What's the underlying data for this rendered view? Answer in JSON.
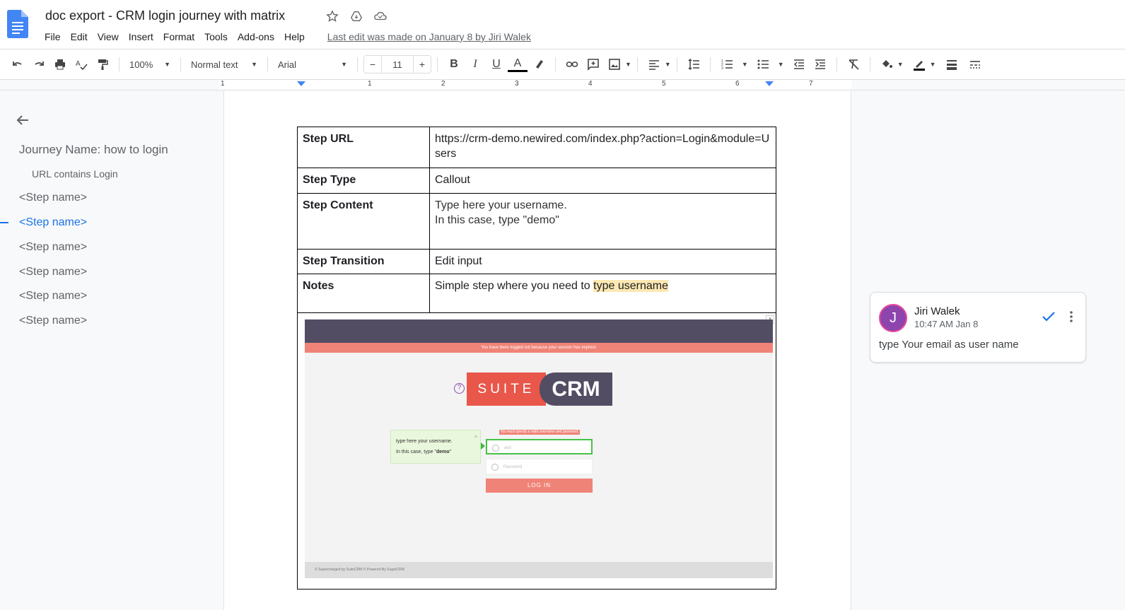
{
  "doc": {
    "title": "doc export - CRM login journey with matrix",
    "last_edit": "Last edit was made on January 8 by Jiri Walek"
  },
  "menu": [
    "File",
    "Edit",
    "View",
    "Insert",
    "Format",
    "Tools",
    "Add-ons",
    "Help"
  ],
  "toolbar": {
    "zoom": "100%",
    "style": "Normal text",
    "font": "Arial",
    "font_size": "11",
    "minus": "−",
    "plus": "+",
    "bold": "B",
    "italic": "I",
    "underline": "U",
    "text_color": "A"
  },
  "ruler": [
    "1",
    "1",
    "2",
    "3",
    "4",
    "5",
    "6",
    "7"
  ],
  "outline": {
    "title": "Journey Name: how to login",
    "subtitle": "URL contains Login",
    "items": [
      "<Step name>",
      "<Step name>",
      "<Step name>",
      "<Step name>",
      "<Step name>",
      "<Step name>"
    ],
    "active_index": 1
  },
  "table": {
    "rows": [
      {
        "key": "Step URL",
        "value": "https://crm-demo.newired.com/index.php?action=Login&module=Users"
      },
      {
        "key": "Step Type",
        "value": "Callout"
      },
      {
        "key": "Step Content",
        "value_line1": "Type here your username.",
        "value_line2": "In this case, type \"demo\""
      },
      {
        "key": "Step Transition",
        "value": "Edit input"
      },
      {
        "key": "Notes",
        "value_prefix": "Simple step where you need to ",
        "value_highlight": "type username"
      }
    ]
  },
  "screenshot": {
    "session_msg": "You have been logged out because your session has expired.",
    "logo_left": "SUITE",
    "logo_right": "CRM",
    "error_msg": "You must specify a valid username and password.",
    "callout_line1": "type here your username.",
    "callout_line2_prefix": "In this case, type \"",
    "callout_line2_bold": "demo",
    "callout_line2_suffix": "\"",
    "username_value": "asd",
    "password_placeholder": "Password",
    "login_label": "LOG IN",
    "footer": "© Supercharged by SuiteCRM     © Powered By SugarCRM"
  },
  "comment": {
    "avatar_letter": "J",
    "author": "Jiri Walek",
    "time": "10:47 AM Jan 8",
    "text": "type Your email as user name"
  },
  "colors": {
    "accent": "#1a73e8",
    "highlight": "#fce8b2",
    "avatar": "#8e44ad",
    "crm_red": "#e8574a",
    "crm_purple": "#534d64"
  }
}
